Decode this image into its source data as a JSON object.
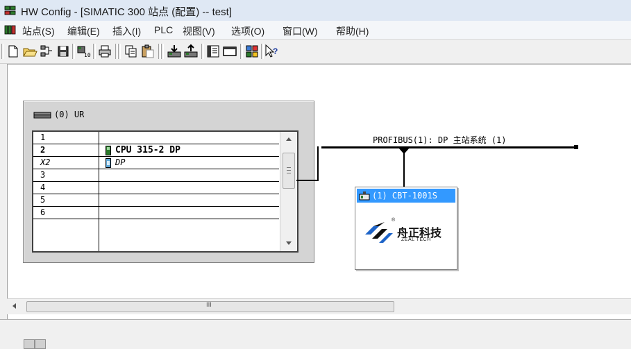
{
  "window": {
    "title": "HW Config - [SIMATIC 300 站点 (配置) -- test]"
  },
  "menu": {
    "items": [
      {
        "label": "站点(S)"
      },
      {
        "label": "编辑(E)"
      },
      {
        "label": "插入(I)"
      },
      {
        "label": "PLC"
      },
      {
        "label": "视图(V)"
      },
      {
        "label": "选项(O)"
      },
      {
        "label": "窗口(W)"
      },
      {
        "label": "帮助(H)"
      }
    ]
  },
  "toolbar": {
    "icons": [
      "new-icon",
      "open-icon",
      "network-icon",
      "save-icon",
      "compile-icon",
      "print-icon",
      "copy-icon",
      "paste-icon",
      "download-icon",
      "upload-icon",
      "catalog-icon",
      "module-icon",
      "station-icon",
      "help-pointer-icon"
    ]
  },
  "rack": {
    "title": "(0) UR",
    "slots": [
      {
        "num": "1",
        "module": "",
        "style": "normal"
      },
      {
        "num": "2",
        "module": "CPU 315-2 DP",
        "style": "bold"
      },
      {
        "num": "X2",
        "module": "DP",
        "style": "ital"
      },
      {
        "num": "3",
        "module": "",
        "style": "normal"
      },
      {
        "num": "4",
        "module": "",
        "style": "normal"
      },
      {
        "num": "5",
        "module": "",
        "style": "normal"
      },
      {
        "num": "6",
        "module": "",
        "style": "normal"
      }
    ]
  },
  "network": {
    "label": "PROFIBUS(1): DP 主站系统 (1)"
  },
  "dp_node": {
    "label": "(1) CBT-1001S",
    "brand_cn": "舟正科技",
    "brand_en": "ZEAL TECH",
    "reg_mark": "®"
  },
  "hscroll": {
    "grip": "III"
  },
  "colors": {
    "selection": "#3399ff",
    "logo_blue": "#1e64c8",
    "logo_dark": "#111111"
  }
}
